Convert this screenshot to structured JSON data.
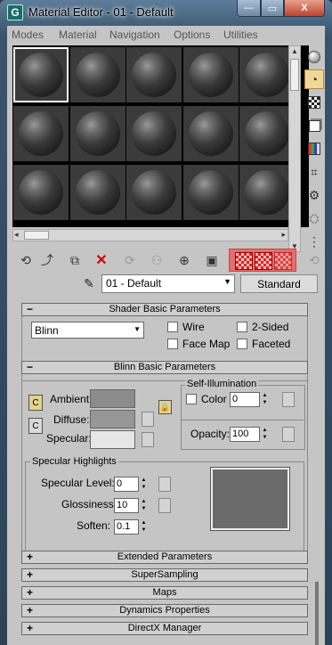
{
  "window": {
    "title": "Material Editor - 01 - Default",
    "app_icon": "G",
    "minimize": "—",
    "maximize": "▭",
    "close": "X"
  },
  "menu": [
    "Modes",
    "Material",
    "Navigation",
    "Options",
    "Utilities"
  ],
  "slots": {
    "rows": 3,
    "cols": 5,
    "active_index": 0
  },
  "material": {
    "name": "01 - Default",
    "type": "Standard"
  },
  "rollouts": {
    "shader_basic": {
      "title": "Shader Basic Parameters",
      "sign": "−",
      "shader": "Blinn",
      "wire": "Wire",
      "two_sided": "2-Sided",
      "face_map": "Face Map",
      "faceted": "Faceted"
    },
    "blinn_basic": {
      "title": "Blinn Basic Parameters",
      "sign": "−",
      "ambient": "Ambient:",
      "diffuse": "Diffuse:",
      "specular": "Specular:",
      "self_illum_title": "Self-Illumination",
      "color": "Color",
      "color_value": "0",
      "opacity": "Opacity:",
      "opacity_value": "100",
      "spec_highlights_title": "Specular Highlights",
      "spec_level": "Specular Level:",
      "spec_level_value": "0",
      "glossiness": "Glossiness:",
      "glossiness_value": "10",
      "soften": "Soften:",
      "soften_value": "0.1"
    },
    "collapsed": [
      {
        "sign": "+",
        "title": "Extended Parameters"
      },
      {
        "sign": "+",
        "title": "SuperSampling"
      },
      {
        "sign": "+",
        "title": "Maps"
      },
      {
        "sign": "+",
        "title": "Dynamics Properties"
      },
      {
        "sign": "+",
        "title": "DirectX Manager"
      }
    ]
  },
  "colors": {
    "ambient_swatch": "#8c8c8c",
    "diffuse_swatch": "#969696",
    "specular_swatch": "#e6e6e6",
    "highlight_group": "#e07070",
    "active_tool": "#f3d69a"
  },
  "icons": {
    "side": [
      "sample-type-sphere-icon",
      "backlight-icon",
      "background-checker-icon",
      "sample-uv-tiling-icon",
      "video-color-check-icon",
      "make-preview-icon",
      "options-icon",
      "select-by-material-icon",
      "material-map-navigator-icon"
    ],
    "lower": [
      "get-material-icon",
      "put-to-scene-icon",
      "assign-to-selection-icon",
      "reset-map-icon",
      "make-unique-icon",
      "put-to-library-icon",
      "material-id-channel-icon",
      "show-map-in-viewport-icon",
      "show-end-result-icon",
      "go-to-parent-icon",
      "go-forward-sibling-icon"
    ]
  }
}
